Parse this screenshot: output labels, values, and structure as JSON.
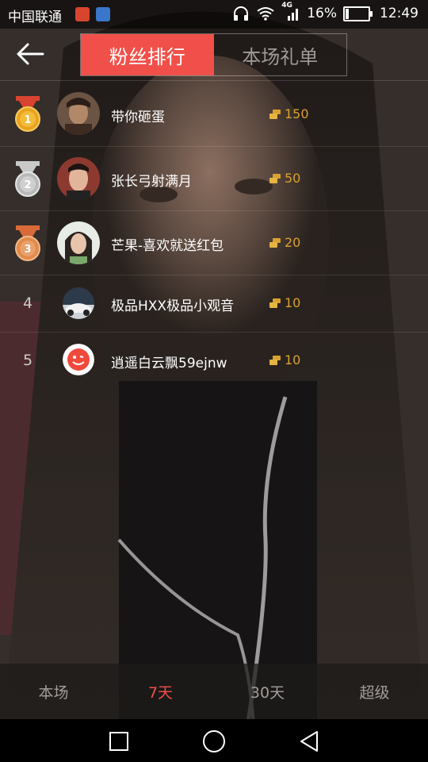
{
  "status_bar": {
    "carrier": "中国联通",
    "network": "4G",
    "battery": "16%",
    "battery_level": 0.16,
    "time": "12:49"
  },
  "header": {
    "tabs": [
      {
        "label": "粉丝排行",
        "active": true
      },
      {
        "label": "本场礼单",
        "active": false
      }
    ]
  },
  "ranking": [
    {
      "rank": "1",
      "name": "带你砸蛋",
      "score": "150"
    },
    {
      "rank": "2",
      "name": "张长弓射满月",
      "score": "50"
    },
    {
      "rank": "3",
      "name": "芒果-喜欢就送红包",
      "score": "20"
    },
    {
      "rank": "4",
      "name": "极品HXX极品小观音",
      "score": "10"
    },
    {
      "rank": "5",
      "name": "逍遥白云飘59ejnw",
      "score": "10"
    }
  ],
  "periods": [
    {
      "label": "本场",
      "active": false
    },
    {
      "label": "7天",
      "active": true
    },
    {
      "label": "30天",
      "active": false
    },
    {
      "label": "超级",
      "active": false
    }
  ],
  "colors": {
    "accent": "#f1504a",
    "score_gold": "#d8a230",
    "gold_medal": "#e9a21f",
    "silver_medal": "#b9b9b9",
    "bronze_medal": "#e08a4a"
  },
  "icons": {
    "back": "arrow-left-icon",
    "coin": "coin-stack-icon",
    "nav": [
      "square-icon",
      "circle-home-icon",
      "triangle-back-icon"
    ]
  }
}
